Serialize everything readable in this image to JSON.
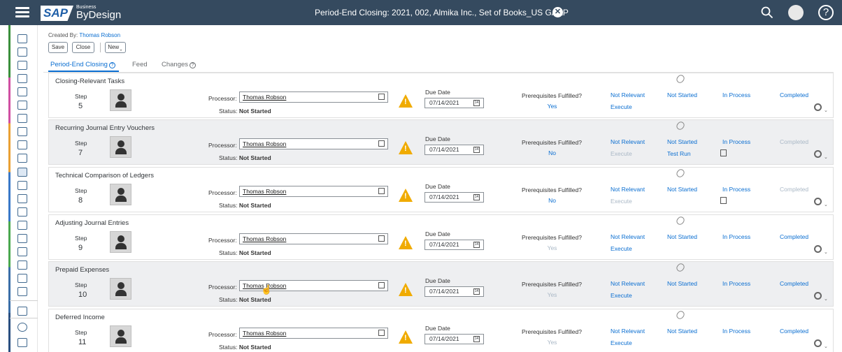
{
  "shell": {
    "logo_sap": "SAP",
    "logo_business": "Business",
    "logo_bydesign": "ByDesign",
    "title": "Period-End Closing: 2021, 002, Almika Inc., Set of Books_US GAAP",
    "close_glyph": "✕",
    "help_glyph": "?"
  },
  "header": {
    "created_by_label": "Created By:",
    "created_by_name": "Thomas Robson",
    "save_label": "Save",
    "close_label": "Close",
    "new_label": "New"
  },
  "tabs": [
    {
      "label": "Period-End Closing",
      "help": "?"
    },
    {
      "label": "Feed"
    },
    {
      "label": "Changes",
      "help": "?"
    }
  ],
  "labels": {
    "step": "Step",
    "processor": "Processor:",
    "status": "Status:",
    "due_date": "Due Date",
    "prerequisites": "Prerequisites Fulfilled?",
    "not_relevant": "Not Relevant",
    "not_started": "Not Started",
    "in_process": "In Process",
    "completed": "Completed"
  },
  "tasks": [
    {
      "name": "Closing-Relevant Tasks",
      "step": "5",
      "processor": "Thomas Robson",
      "status": "Not Started",
      "due": "07/14/2021",
      "prereq": "Yes",
      "action_nr": "Execute",
      "action_ns": "",
      "completed_enabled": true
    },
    {
      "name": "Recurring Journal Entry Vouchers",
      "step": "7",
      "processor": "Thomas Robson",
      "status": "Not Started",
      "due": "07/14/2021",
      "prereq": "No",
      "action_nr": "Execute",
      "action_ns": "Test Run",
      "completed_enabled": false
    },
    {
      "name": "Technical Comparison of Ledgers",
      "step": "8",
      "processor": "Thomas Robson",
      "status": "Not Started",
      "due": "07/14/2021",
      "prereq": "No",
      "action_nr": "Execute",
      "action_ns": "",
      "completed_enabled": false
    },
    {
      "name": "Adjusting Journal Entries",
      "step": "9",
      "processor": "Thomas Robson",
      "status": "Not Started",
      "due": "07/14/2021",
      "prereq": "Yes",
      "action_nr": "Execute",
      "action_ns": "",
      "completed_enabled": true
    },
    {
      "name": "Prepaid Expenses",
      "step": "10",
      "processor": "Thomas Robson",
      "status": "Not Started",
      "due": "07/14/2021",
      "prereq": "Yes",
      "action_nr": "Execute",
      "action_ns": "",
      "completed_enabled": true
    },
    {
      "name": "Deferred Income",
      "step": "11",
      "processor": "Thomas Robson",
      "status": "Not Started",
      "due": "07/14/2021",
      "prereq": "Yes",
      "action_nr": "Execute",
      "action_ns": "",
      "completed_enabled": true
    }
  ],
  "colors": {
    "shell": "#354a5f",
    "link": "#0a6ed1",
    "warning": "#f0ab00",
    "disabled_link": "#aab8c6"
  }
}
